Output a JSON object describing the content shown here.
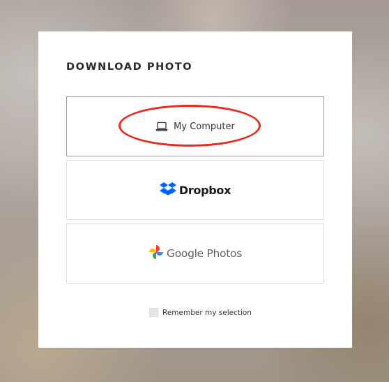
{
  "modal": {
    "title": "DOWNLOAD PHOTO",
    "options": [
      {
        "label": "My Computer",
        "icon": "laptop-icon",
        "selected": true
      },
      {
        "label": "Dropbox",
        "icon": "dropbox-icon"
      },
      {
        "label": "Google Photos",
        "icon": "google-photos-icon"
      }
    ],
    "remember_label": "Remember my selection",
    "remember_checked": false
  },
  "colors": {
    "highlight": "#e8291c",
    "dropbox_blue": "#0061fe",
    "title_text": "#2b2b2b"
  }
}
